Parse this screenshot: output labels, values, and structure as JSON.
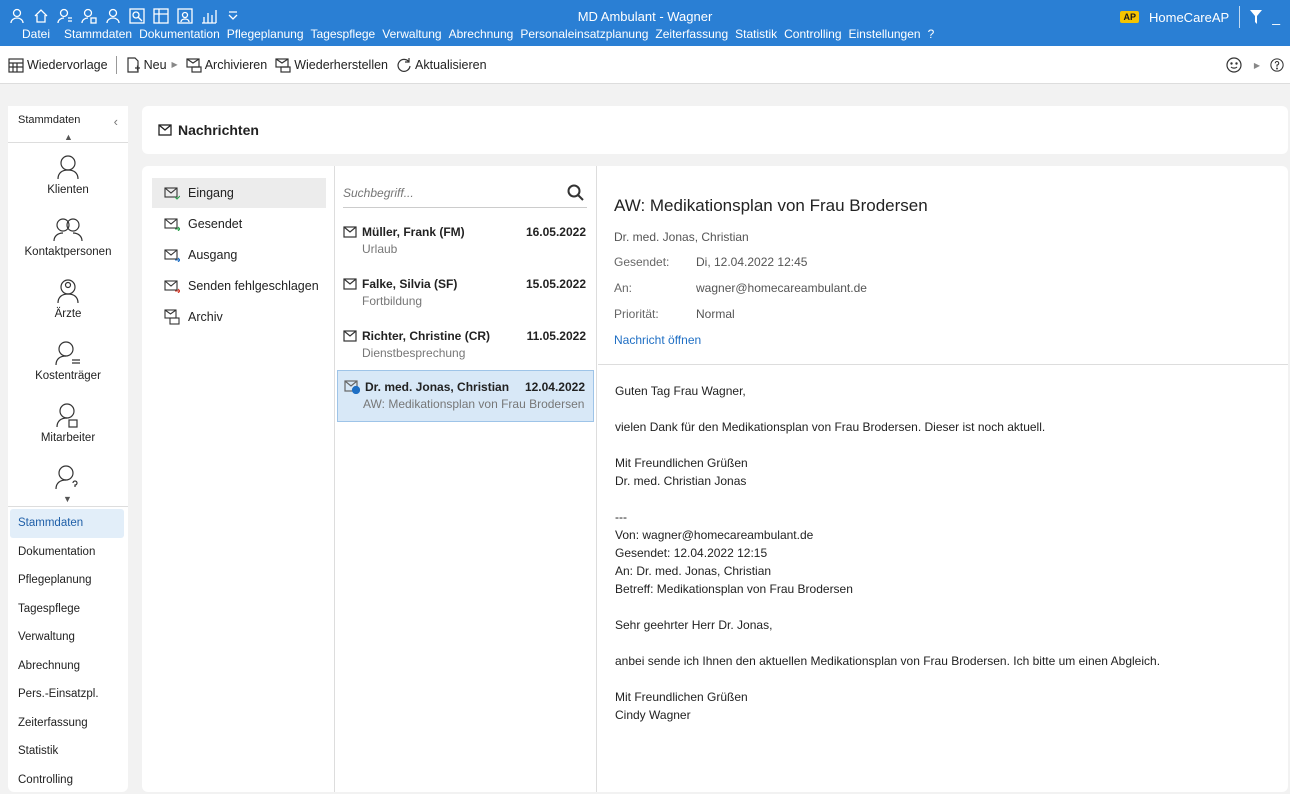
{
  "window": {
    "title": "MD Ambulant - Wagner",
    "badge": "AP",
    "user": "HomeCareAP",
    "minimize": "_"
  },
  "menu": [
    "Datei",
    "Stammdaten",
    "Dokumentation",
    "Pflegeplanung",
    "Tagespflege",
    "Verwaltung",
    "Abrechnung",
    "Personaleinsatzplanung",
    "Zeiterfassung",
    "Statistik",
    "Controlling",
    "Einstellungen",
    "?"
  ],
  "toolbar": {
    "wiedervorlage": "Wiedervorlage",
    "neu": "Neu",
    "archivieren": "Archivieren",
    "wiederherstellen": "Wiederherstellen",
    "aktualisieren": "Aktualisieren"
  },
  "leftnav": {
    "header": "Stammdaten",
    "big_items": [
      "Klienten",
      "Kontaktpersonen",
      "Ärzte",
      "Kostenträger",
      "Mitarbeiter"
    ],
    "list": [
      "Stammdaten",
      "Dokumentation",
      "Pflegeplanung",
      "Tagespflege",
      "Verwaltung",
      "Abrechnung",
      "Pers.-Einsatzpl.",
      "Zeiterfassung",
      "Statistik",
      "Controlling"
    ]
  },
  "page": {
    "title": "Nachrichten"
  },
  "folders": [
    "Eingang",
    "Gesendet",
    "Ausgang",
    "Senden fehlgeschlagen",
    "Archiv"
  ],
  "search": {
    "placeholder": "Suchbegriff..."
  },
  "messages": [
    {
      "sender": "Müller, Frank (FM)",
      "date": "16.05.2022",
      "subject": "Urlaub"
    },
    {
      "sender": "Falke, Silvia (SF)",
      "date": "15.05.2022",
      "subject": "Fortbildung"
    },
    {
      "sender": "Richter, Christine (CR)",
      "date": "11.05.2022",
      "subject": "Dienstbesprechung"
    },
    {
      "sender": "Dr. med. Jonas, Christian",
      "date": "12.04.2022",
      "subject": "AW: Medikationsplan von Frau Brodersen"
    }
  ],
  "reader": {
    "subject": "AW: Medikationsplan von Frau Brodersen",
    "from": "Dr. med. Jonas, Christian",
    "sent_label": "Gesendet:",
    "sent_value": "Di, 12.04.2022 12:45",
    "to_label": "An:",
    "to_value": "wagner@homecareambulant.de",
    "prio_label": "Priorität:",
    "prio_value": "Normal",
    "open_link": "Nachricht öffnen",
    "body": [
      "Guten Tag Frau Wagner,",
      "vielen Dank für den Medikationsplan von Frau Brodersen. Dieser ist noch aktuell.",
      "Mit Freundlichen Grüßen\nDr. med. Christian Jonas",
      "---\nVon: wagner@homecareambulant.de\nGesendet: 12.04.2022 12:15\nAn: Dr. med. Jonas, Christian\nBetreff: Medikationsplan von Frau Brodersen",
      "Sehr geehrter Herr Dr. Jonas,",
      "anbei sende ich Ihnen den aktuellen Medikationsplan von Frau Brodersen. Ich bitte um einen Abgleich.",
      "Mit Freundlichen Grüßen\nCindy Wagner"
    ]
  }
}
